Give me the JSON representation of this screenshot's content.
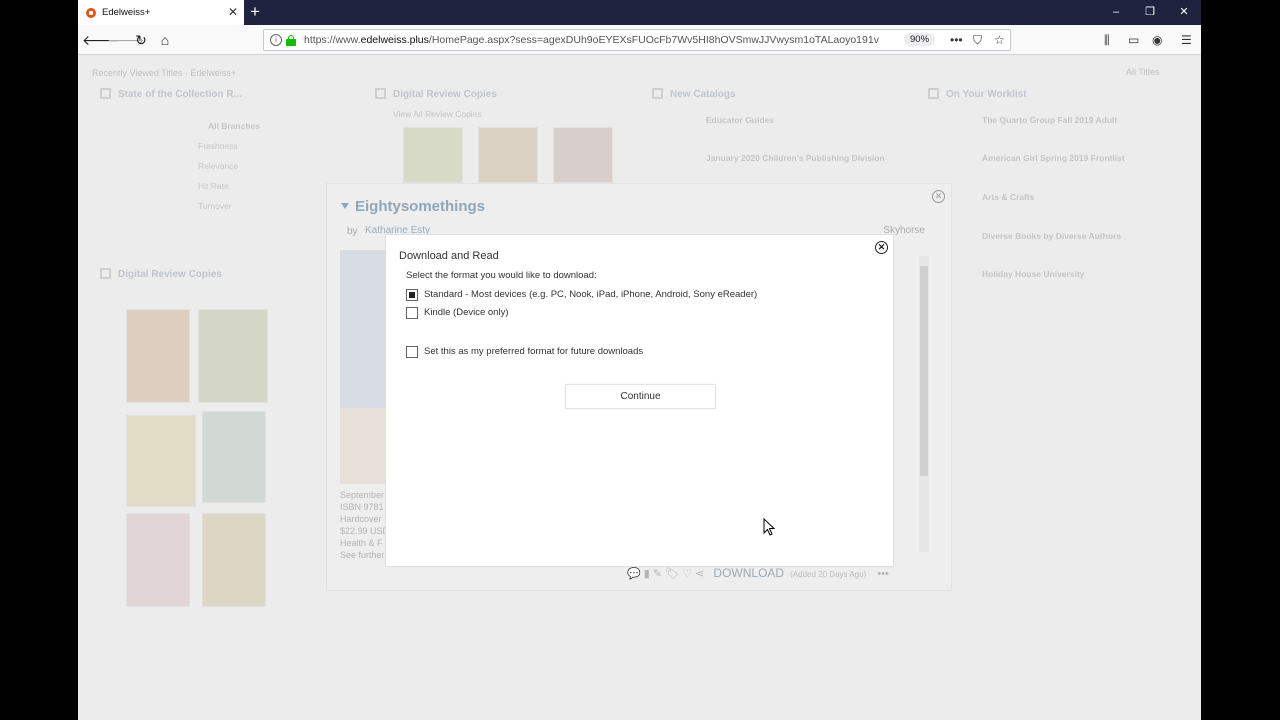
{
  "browser": {
    "tab_title": "Edelweiss+",
    "new_tab_symbol": "+",
    "url_prefix": "https://www.",
    "url_host": "edelweiss.plus",
    "url_rest": "/HomePage.aspx?sess=agexDUh9oEYEXsFUOcFb7Wv5HI8hOVSmwJJVwysm1oTALaoyo191v4g5P6I",
    "zoom": "90%",
    "window_controls": [
      "–",
      "❐",
      "✕"
    ]
  },
  "background_page": {
    "header_text": "Recently Viewed Titles · Edelweiss+",
    "user_link": "All Titles",
    "widgets": [
      {
        "title": "State of the Collection R...",
        "rows": [
          "All Branches",
          "Freshness",
          "Relevance",
          "Hit Rate",
          "Turnover"
        ]
      },
      {
        "title": "Digital Review Copies",
        "rows": [
          "View All Review Copies"
        ]
      },
      {
        "title": "New Catalogs",
        "rows": [
          "Educator Guides",
          "January 2020 Children's Publishing Division"
        ]
      },
      {
        "title": "On Your Worklist",
        "rows": [
          "The Quarto Group Fall 2019 Adult",
          "American Girl Spring 2019 Frontlist",
          "Arts & Crafts",
          "Diverse Books by Diverse Authors",
          "Holiday House University"
        ]
      }
    ],
    "lower_widget_title": "Digital Review Copies"
  },
  "book_modal": {
    "title": "Eightysomethings",
    "by_label": "by",
    "author": "Katharine Esty",
    "publisher": "Skyhorse",
    "meta_lines": [
      "September",
      "ISBN 9781",
      "Hardcover",
      "$22.99 USD",
      "Health & F",
      "See further"
    ],
    "download_label": "DOWNLOAD",
    "added_text": "(Added 20 Days Ago)",
    "more_label": "•••"
  },
  "dialog": {
    "title": "Download and Read",
    "prompt": "Select the format you would like to download:",
    "options": [
      {
        "label": "Standard - Most devices (e.g. PC, Nook, iPad, iPhone, Android, Sony eReader)",
        "checked": true
      },
      {
        "label": "Kindle (Device only)",
        "checked": false
      }
    ],
    "preferred_label": "Set this as my preferred format for future downloads",
    "preferred_checked": false,
    "continue_label": "Continue",
    "close_symbol": "✕"
  }
}
